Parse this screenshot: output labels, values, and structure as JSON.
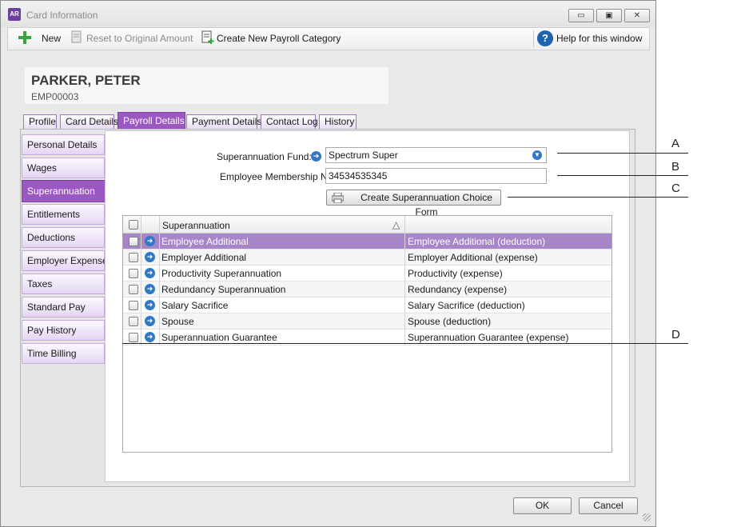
{
  "window": {
    "app_icon": "AR",
    "title": "Card Information",
    "minimize_glyph": "▭",
    "maximize_glyph": "▣",
    "close_glyph": "✕"
  },
  "toolbar": {
    "new_label": "New",
    "reset_label": "Reset to Original Amount",
    "create_category_label": "Create New Payroll Category",
    "help_label": "Help for this window",
    "help_glyph": "?"
  },
  "card": {
    "name": "PARKER, PETER",
    "id": "EMP00003"
  },
  "tabs": [
    {
      "label": "Profile"
    },
    {
      "label": "Card Details"
    },
    {
      "label": "Payroll Details"
    },
    {
      "label": "Payment Details"
    },
    {
      "label": "Contact Log"
    },
    {
      "label": "History"
    }
  ],
  "sidebar": {
    "items": [
      {
        "label": "Personal Details"
      },
      {
        "label": "Wages"
      },
      {
        "label": "Superannuation"
      },
      {
        "label": "Entitlements"
      },
      {
        "label": "Deductions"
      },
      {
        "label": "Employer Expenses"
      },
      {
        "label": "Taxes"
      },
      {
        "label": "Standard Pay"
      },
      {
        "label": "Pay History"
      },
      {
        "label": "Time Billing"
      }
    ]
  },
  "form": {
    "fund_label": "Superannuation Fund:",
    "fund_value": "Spectrum Super",
    "membership_label": "Employee Membership No:",
    "membership_value": "34534535345",
    "choice_form_button": "Create Superannuation Choice Form"
  },
  "grid": {
    "column_header": "Superannuation",
    "sort_glyph": "△",
    "rows": [
      {
        "name": "Employee Additional",
        "category": "Employee Additional (deduction)",
        "selected": true
      },
      {
        "name": "Employer Additional",
        "category": "Employer Additional (expense)"
      },
      {
        "name": "Productivity Superannuation",
        "category": "Productivity (expense)"
      },
      {
        "name": "Redundancy Superannuation",
        "category": "Redundancy (expense)"
      },
      {
        "name": "Salary Sacrifice",
        "category": "Salary Sacrifice (deduction)"
      },
      {
        "name": "Spouse",
        "category": "Spouse (deduction)"
      },
      {
        "name": "Superannuation Guarantee",
        "category": "Superannuation Guarantee (expense)"
      }
    ]
  },
  "footer": {
    "ok_label": "OK",
    "cancel_label": "Cancel"
  },
  "callouts": {
    "a": "A",
    "b": "B",
    "c": "C",
    "d": "D"
  },
  "colors": {
    "accent_purple": "#9b58c0",
    "selected_row": "#a686c6",
    "link_blue": "#2f79c7"
  }
}
